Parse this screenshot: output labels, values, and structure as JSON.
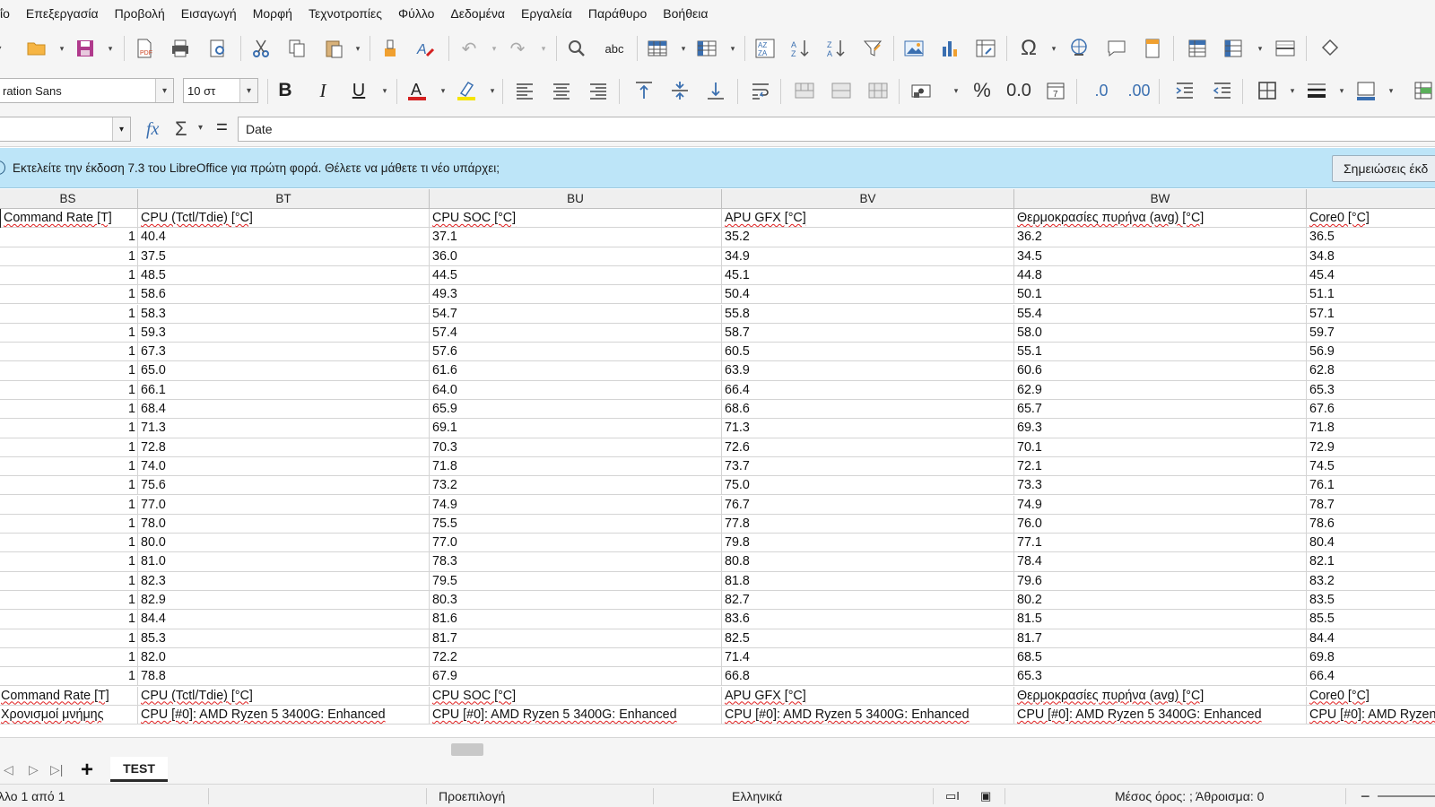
{
  "menu": [
    "ΐο",
    "Επεξεργασία",
    "Προβολή",
    "Εισαγωγή",
    "Μορφή",
    "Τεχνοτροπίες",
    "Φύλλο",
    "Δεδομένα",
    "Εργαλεία",
    "Παράθυρο",
    "Βοήθεια"
  ],
  "format_toolbar": {
    "font_name": "ration Sans",
    "font_size": "10 στ",
    "bold": "B",
    "italic": "I",
    "underline": "U",
    "percent": "%",
    "number_format": "0.0",
    "add_decimal": ".0",
    "remove_decimal": ".00"
  },
  "formula_bar": {
    "name_box": "",
    "fx": "fx",
    "sigma": "Σ",
    "equals": "=",
    "content": "Date"
  },
  "infobar": {
    "message": "Εκτελείτε την έκδοση 7.3 του LibreOffice για πρώτη φορά. Θέλετε να μάθετε τι νέο υπάρχει;",
    "button": "Σημειώσεις έκδ"
  },
  "columns": [
    "BS",
    "BT",
    "BU",
    "BV",
    "BW",
    ""
  ],
  "rows": [
    [
      "Command Rate [T]",
      "CPU (Tctl/Tdie) [°C]",
      "CPU SOC [°C]",
      "APU GFX [°C]",
      "Θερμοκρασίες πυρήνα (avg) [°C]",
      "Core0 [°C]"
    ],
    [
      "1",
      "40.4",
      "37.1",
      "35.2",
      "36.2",
      "36.5"
    ],
    [
      "1",
      "37.5",
      "36.0",
      "34.9",
      "34.5",
      "34.8"
    ],
    [
      "1",
      "48.5",
      "44.5",
      "45.1",
      "44.8",
      "45.4"
    ],
    [
      "1",
      "58.6",
      "49.3",
      "50.4",
      "50.1",
      "51.1"
    ],
    [
      "1",
      "58.3",
      "54.7",
      "55.8",
      "55.4",
      "57.1"
    ],
    [
      "1",
      "59.3",
      "57.4",
      "58.7",
      "58.0",
      "59.7"
    ],
    [
      "1",
      "67.3",
      "57.6",
      "60.5",
      "55.1",
      "56.9"
    ],
    [
      "1",
      "65.0",
      "61.6",
      "63.9",
      "60.6",
      "62.8"
    ],
    [
      "1",
      "66.1",
      "64.0",
      "66.4",
      "62.9",
      "65.3"
    ],
    [
      "1",
      "68.4",
      "65.9",
      "68.6",
      "65.7",
      "67.6"
    ],
    [
      "1",
      "71.3",
      "69.1",
      "71.3",
      "69.3",
      "71.8"
    ],
    [
      "1",
      "72.8",
      "70.3",
      "72.6",
      "70.1",
      "72.9"
    ],
    [
      "1",
      "74.0",
      "71.8",
      "73.7",
      "72.1",
      "74.5"
    ],
    [
      "1",
      "75.6",
      "73.2",
      "75.0",
      "73.3",
      "76.1"
    ],
    [
      "1",
      "77.0",
      "74.9",
      "76.7",
      "74.9",
      "78.7"
    ],
    [
      "1",
      "78.0",
      "75.5",
      "77.8",
      "76.0",
      "78.6"
    ],
    [
      "1",
      "80.0",
      "77.0",
      "79.8",
      "77.1",
      "80.4"
    ],
    [
      "1",
      "81.0",
      "78.3",
      "80.8",
      "78.4",
      "82.1"
    ],
    [
      "1",
      "82.3",
      "79.5",
      "81.8",
      "79.6",
      "83.2"
    ],
    [
      "1",
      "82.9",
      "80.3",
      "82.7",
      "80.2",
      "83.5"
    ],
    [
      "1",
      "84.4",
      "81.6",
      "83.6",
      "81.5",
      "85.5"
    ],
    [
      "1",
      "85.3",
      "81.7",
      "82.5",
      "81.7",
      "84.4"
    ],
    [
      "1",
      "82.0",
      "72.2",
      "71.4",
      "68.5",
      "69.8"
    ],
    [
      "1",
      "78.8",
      "67.9",
      "66.8",
      "65.3",
      "66.4"
    ],
    [
      "Command Rate [T]",
      "CPU (Tctl/Tdie) [°C]",
      "CPU SOC [°C]",
      "APU GFX [°C]",
      "Θερμοκρασίες πυρήνα (avg) [°C]",
      "Core0 [°C]"
    ],
    [
      "Χρονισμοί μνήμης",
      "CPU [#0]: AMD Ryzen 5 3400G: Enhanced",
      "CPU [#0]: AMD Ryzen 5 3400G: Enhanced",
      "CPU [#0]: AMD Ryzen 5 3400G: Enhanced",
      "CPU [#0]: AMD Ryzen 5 3400G: Enhanced",
      "CPU [#0]: AMD Ryzen 5 3400G: Enhanced"
    ]
  ],
  "sheet_tab": "TEST",
  "status": {
    "sheet_pos": "λλο 1 από 1",
    "page_style": "Προεπιλογή",
    "language": "Ελληνικά",
    "summary": "Μέσος όρος: ; Άθροισμα: 0",
    "zoom_minus": "−"
  },
  "colors": {
    "accent_blue": "#3a6fb0",
    "infobar_bg": "#bde5f8",
    "font_color_red": "#d42020",
    "highlight_yellow": "#f5e400"
  }
}
